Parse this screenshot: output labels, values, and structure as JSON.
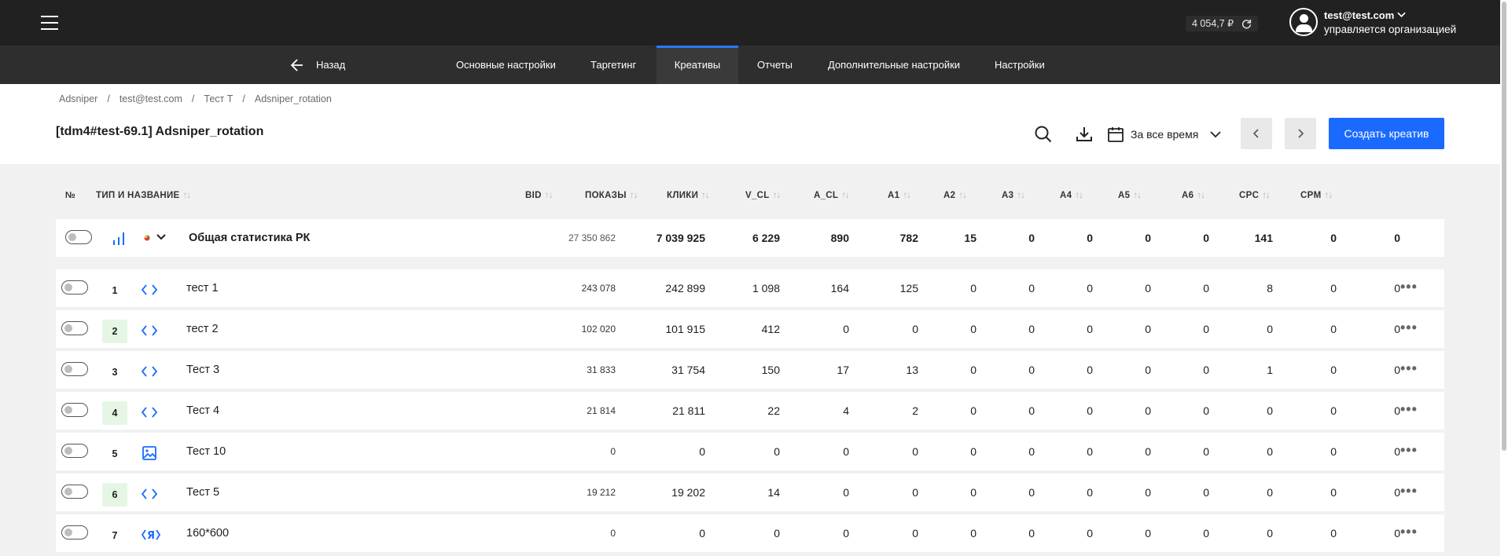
{
  "topbar": {
    "balance": "4 054,7 ₽",
    "user_email": "test@test.com",
    "user_org": "управляется организацией"
  },
  "nav": {
    "back_label": "Назад",
    "tabs": [
      {
        "label": "Основные настройки",
        "active": false
      },
      {
        "label": "Таргетинг",
        "active": false
      },
      {
        "label": "Креативы",
        "active": true
      },
      {
        "label": "Отчеты",
        "active": false
      },
      {
        "label": "Дополнительные настройки",
        "active": false
      },
      {
        "label": "Настройки",
        "active": false
      }
    ]
  },
  "breadcrumb": [
    "Adsniper",
    "test@test.com",
    "Тест Т",
    "Adsniper_rotation"
  ],
  "page_title": "[tdm4#test-69.1] Adsniper_rotation",
  "period_label": "За все время",
  "create_button": "Создать креатив",
  "accent_color": "#1a6aff",
  "columns": {
    "num": "№",
    "type_name": "ТИП И НАЗВАНИЕ",
    "bid": "BID",
    "impressions": "ПОКАЗЫ",
    "clicks": "КЛИКИ",
    "v_cl": "V_CL",
    "a_cl": "A_CL",
    "a1": "A1",
    "a2": "A2",
    "a3": "A3",
    "a4": "A4",
    "a5": "A5",
    "a6": "A6",
    "cpc": "CPC",
    "cpm": "CPM"
  },
  "summary": {
    "name": "Общая статистика РК",
    "bid": "27 350 862",
    "impressions": "7 039 925",
    "clicks": "6 229",
    "v_cl": "890",
    "a_cl": "782",
    "a1": "15",
    "a2": "0",
    "a3": "0",
    "a4": "0",
    "a5": "0",
    "a6": "141",
    "cpc": "0",
    "cpm": "0"
  },
  "rows": [
    {
      "num": "1",
      "icon": "code-icon",
      "name": "тест 1",
      "bid": "243 078",
      "impressions": "242 899",
      "clicks": "1 098",
      "v_cl": "164",
      "a_cl": "125",
      "a1": "0",
      "a2": "0",
      "a3": "0",
      "a4": "0",
      "a5": "0",
      "a6": "8",
      "cpc": "0",
      "cpm": "0"
    },
    {
      "num": "2",
      "icon": "code-icon",
      "name": "тест 2",
      "bid": "102 020",
      "impressions": "101 915",
      "clicks": "412",
      "v_cl": "0",
      "a_cl": "0",
      "a1": "0",
      "a2": "0",
      "a3": "0",
      "a4": "0",
      "a5": "0",
      "a6": "0",
      "cpc": "0",
      "cpm": "0"
    },
    {
      "num": "3",
      "icon": "code-icon",
      "name": "Тест 3",
      "bid": "31 833",
      "impressions": "31 754",
      "clicks": "150",
      "v_cl": "17",
      "a_cl": "13",
      "a1": "0",
      "a2": "0",
      "a3": "0",
      "a4": "0",
      "a5": "0",
      "a6": "1",
      "cpc": "0",
      "cpm": "0"
    },
    {
      "num": "4",
      "icon": "code-icon",
      "name": "Тест 4",
      "bid": "21 814",
      "impressions": "21 811",
      "clicks": "22",
      "v_cl": "4",
      "a_cl": "2",
      "a1": "0",
      "a2": "0",
      "a3": "0",
      "a4": "0",
      "a5": "0",
      "a6": "0",
      "cpc": "0",
      "cpm": "0"
    },
    {
      "num": "5",
      "icon": "image-icon",
      "name": "Тест 10",
      "bid": "0",
      "impressions": "0",
      "clicks": "0",
      "v_cl": "0",
      "a_cl": "0",
      "a1": "0",
      "a2": "0",
      "a3": "0",
      "a4": "0",
      "a5": "0",
      "a6": "0",
      "cpc": "0",
      "cpm": "0"
    },
    {
      "num": "6",
      "icon": "code-icon",
      "name": "Тест 5",
      "bid": "19 212",
      "impressions": "19 202",
      "clicks": "14",
      "v_cl": "0",
      "a_cl": "0",
      "a1": "0",
      "a2": "0",
      "a3": "0",
      "a4": "0",
      "a5": "0",
      "a6": "0",
      "cpc": "0",
      "cpm": "0"
    },
    {
      "num": "7",
      "icon": "yandex-code-icon",
      "name": "160*600",
      "bid": "0",
      "impressions": "0",
      "clicks": "0",
      "v_cl": "0",
      "a_cl": "0",
      "a1": "0",
      "a2": "0",
      "a3": "0",
      "a4": "0",
      "a5": "0",
      "a6": "0",
      "cpc": "0",
      "cpm": "0"
    }
  ]
}
